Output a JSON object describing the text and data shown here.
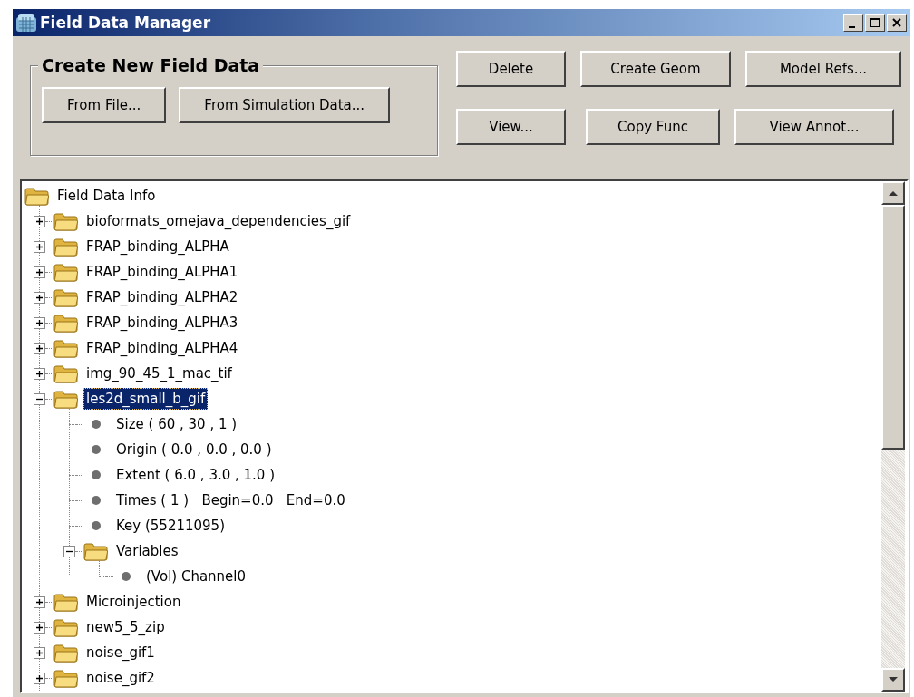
{
  "window": {
    "title": "Field Data Manager"
  },
  "create_group": {
    "title": "Create New Field Data",
    "buttons": [
      "From File...",
      "From Simulation Data..."
    ]
  },
  "action_buttons": [
    [
      "Delete",
      "Create Geom",
      "Model Refs..."
    ],
    [
      "View...",
      "Copy Func",
      "View Annot..."
    ]
  ],
  "tree": {
    "kind": "folder",
    "label": "Field Data Info",
    "selected": false,
    "children": [
      {
        "kind": "folder",
        "label": "bioformats_omejava_dependencies_gif",
        "expanded": false,
        "selected": false
      },
      {
        "kind": "folder",
        "label": "FRAP_binding_ALPHA",
        "expanded": false,
        "selected": false
      },
      {
        "kind": "folder",
        "label": "FRAP_binding_ALPHA1",
        "expanded": false,
        "selected": false
      },
      {
        "kind": "folder",
        "label": "FRAP_binding_ALPHA2",
        "expanded": false,
        "selected": false
      },
      {
        "kind": "folder",
        "label": "FRAP_binding_ALPHA3",
        "expanded": false,
        "selected": false
      },
      {
        "kind": "folder",
        "label": "FRAP_binding_ALPHA4",
        "expanded": false,
        "selected": false
      },
      {
        "kind": "folder",
        "label": "img_90_45_1_mac_tif",
        "expanded": false,
        "selected": false
      },
      {
        "kind": "folder",
        "label": "les2d_small_b_gif",
        "expanded": true,
        "selected": true,
        "children": [
          {
            "kind": "leaf",
            "label": "Size ( 60 , 30 , 1 )",
            "selected": false
          },
          {
            "kind": "leaf",
            "label": "Origin ( 0.0 , 0.0 , 0.0 )",
            "selected": false
          },
          {
            "kind": "leaf",
            "label": "Extent ( 6.0 , 3.0 , 1.0 )",
            "selected": false
          },
          {
            "kind": "leaf",
            "label": "Times ( 1 )   Begin=0.0   End=0.0",
            "selected": false
          },
          {
            "kind": "leaf",
            "label": "Key (55211095)",
            "selected": false
          },
          {
            "kind": "folder",
            "label": "Variables",
            "expanded": true,
            "selected": false,
            "children": [
              {
                "kind": "leaf",
                "label": "(Vol) Channel0",
                "selected": false
              }
            ]
          }
        ]
      },
      {
        "kind": "folder",
        "label": "Microinjection",
        "expanded": false,
        "selected": false
      },
      {
        "kind": "folder",
        "label": "new5_5_zip",
        "expanded": false,
        "selected": false
      },
      {
        "kind": "folder",
        "label": "noise_gif1",
        "expanded": false,
        "selected": false
      },
      {
        "kind": "folder",
        "label": "noise_gif2",
        "expanded": false,
        "selected": false
      }
    ]
  }
}
